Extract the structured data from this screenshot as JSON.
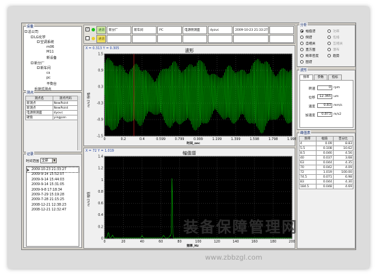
{
  "device_tree": {
    "title": "设备",
    "items": [
      {
        "label": "总公司",
        "level": 0
      },
      {
        "label": "LG化学",
        "level": 1
      },
      {
        "label": "空调系统",
        "level": 2
      },
      {
        "label": "m06",
        "level": 3
      },
      {
        "label": "M11",
        "level": 3
      },
      {
        "label": "新设备",
        "level": 3
      },
      {
        "label": "新分厂",
        "level": 1
      },
      {
        "label": "新车间",
        "level": 2
      },
      {
        "label": "cs",
        "level": 3
      },
      {
        "label": "pc",
        "level": 3
      },
      {
        "label": "平衡台",
        "level": 3
      },
      {
        "label": "手持式测点",
        "level": 1
      }
    ]
  },
  "points": {
    "title": "测点",
    "headers": [
      "测点名",
      "测点代码"
    ],
    "rows": [
      [
        "新测点",
        "NewPoint"
      ],
      [
        "新测点",
        "NewPoint"
      ],
      [
        "电源侧测面",
        "dyovc"
      ],
      [
        "硬盘",
        "yingpan"
      ]
    ]
  },
  "records": {
    "title": "记录",
    "range_label": "时间范围",
    "range_value": "全部",
    "items": [
      "2009-10-23 21:33:27",
      "2009-9-14 15:52:07",
      "2009-9-14 15:44:03",
      "2009-9-14 15:31:05",
      "2009-9-8 17:18:34",
      "2009-7-29 15:19:28",
      "2009-7-28 21:15:25",
      "2008-12-21 12:38:23",
      "2008-12-21 12:32:47"
    ]
  },
  "toolbar": {
    "row1": {
      "status": "通道",
      "factory": "新分厂",
      "workshop": "新车间",
      "device": "PC",
      "point": "电源侧测面",
      "code": "dyovc",
      "time": "2009-10-23 21:33:27"
    },
    "row2": {
      "status": "通道"
    }
  },
  "waveform": {
    "title": "波形",
    "cursor": "X = 0.313  Y = 0.305",
    "ylabel": "m/s2 振幅",
    "xlabel": "时间_sec",
    "y_ticks": [
      "1.5",
      "0.9",
      "0.3",
      "-0.3",
      "-0.9",
      "-1.5"
    ],
    "x_ticks": [
      "0",
      "0.2",
      "0.4",
      "0.599",
      "0.799",
      "0.999",
      "1.199",
      "1.399",
      "1.598",
      "1.798",
      "1.998"
    ]
  },
  "spectrum": {
    "title": "幅值谱",
    "cursor": "X = 72  Y = 1.019",
    "ylabel": "m/s2 幅值",
    "xlabel": "频率_Hz",
    "y_ticks": [
      "1.4",
      "1.2",
      "1",
      "0.8",
      "0.6",
      "0.4",
      "0.2",
      "0"
    ],
    "x_ticks": [
      "0",
      "20",
      "40",
      "60",
      "80",
      "100",
      "120",
      "140",
      "160",
      "180",
      "200"
    ]
  },
  "chart_data": [
    {
      "type": "line",
      "title": "波形",
      "xlabel": "时间_sec",
      "ylabel": "m/s2 振幅",
      "xlim": [
        0,
        1.998
      ],
      "ylim": [
        -1.5,
        1.5
      ],
      "grid": true,
      "series": [
        {
          "color": "#00c000",
          "description_values": {
            "carrier_hz": 72,
            "envelope_min": 0.6,
            "envelope_max": 1.3
          }
        }
      ]
    },
    {
      "type": "line",
      "title": "幅值谱",
      "xlabel": "频率_Hz",
      "ylabel": "m/s2 幅值",
      "xlim": [
        0,
        200
      ],
      "ylim": [
        0,
        1.4
      ],
      "grid": true,
      "series": [
        {
          "color": "#00c000",
          "peaks": [
            [
              72,
              1.019
            ],
            [
              4,
              0.09
            ],
            [
              8.5,
              0.045
            ],
            [
              40,
              0.037
            ],
            [
              63,
              0.044
            ],
            [
              70,
              0.042
            ]
          ]
        }
      ]
    }
  ],
  "analysis": {
    "title": "分析",
    "options": [
      {
        "label": "幅值谱",
        "on": true,
        "dim": false
      },
      {
        "label": "功率",
        "on": false,
        "dim": true
      },
      {
        "label": "倒谱",
        "on": false,
        "dim": false
      },
      {
        "label": "包络",
        "on": false,
        "dim": true
      },
      {
        "label": "自相关",
        "on": false,
        "dim": false
      },
      {
        "label": "互相关",
        "on": false,
        "dim": true
      },
      {
        "label": "直方图",
        "on": false,
        "dim": false
      },
      {
        "label": "瀑布",
        "on": false,
        "dim": true
      },
      {
        "label": "概率密度",
        "on": false,
        "dim": false
      },
      {
        "label": "趋势",
        "on": false,
        "dim": false
      },
      {
        "label": "图谱",
        "on": false,
        "dim": false
      }
    ]
  },
  "waveform_panel": {
    "title": "波形",
    "tabs": [
      "频率",
      "参数",
      "指标"
    ],
    "rows": [
      {
        "label": "转速",
        "value": "0",
        "unit": "rpm"
      },
      {
        "label": "位移",
        "value": "12.365",
        "unit": "um"
      },
      {
        "label": "速度",
        "value": "0.83",
        "unit": "mm/s"
      },
      {
        "label": "加速度",
        "value": "0.873",
        "unit": "m/s2"
      }
    ]
  },
  "peaks": {
    "title": "峰值表",
    "headers": [
      "频率",
      "幅值",
      "百分比"
    ],
    "rows": [
      [
        "4",
        "0.09",
        "8.83"
      ],
      [
        "5.5",
        "0.108",
        "10.62"
      ],
      [
        "8.5",
        "0.046",
        "4.56"
      ],
      [
        "40",
        "0.037",
        "3.68"
      ],
      [
        "63",
        "0.044",
        "4.35"
      ],
      [
        "70",
        "0.042",
        "4.09"
      ],
      [
        "72",
        "1.019",
        "100.00"
      ],
      [
        "74.5",
        "0.071",
        "6.98"
      ],
      [
        "83",
        "0.044",
        "4.30"
      ],
      [
        "184.5",
        "0.048",
        "4.69"
      ]
    ]
  },
  "watermark": {
    "text": "装备保障管理网",
    "url": "www.zbbzgl.com"
  }
}
